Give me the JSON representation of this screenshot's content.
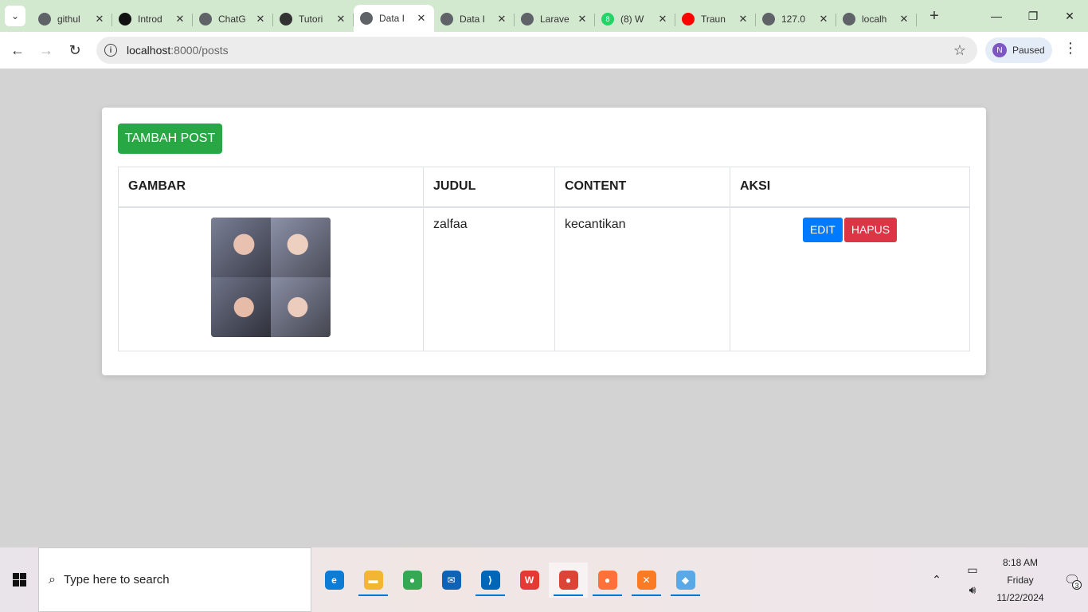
{
  "browser": {
    "tabs": [
      {
        "title": "githul",
        "favicon": "globe-icon",
        "color": "#5f6368"
      },
      {
        "title": "Introd",
        "favicon": "openai-icon",
        "color": "#111111"
      },
      {
        "title": "ChatG",
        "favicon": "openai-icon",
        "color": "#5f6368"
      },
      {
        "title": "Tutori",
        "favicon": "github-icon",
        "color": "#333333"
      },
      {
        "title": "Data I",
        "favicon": "globe-icon",
        "color": "#5f6368",
        "active": true
      },
      {
        "title": "Data I",
        "favicon": "globe-icon",
        "color": "#5f6368"
      },
      {
        "title": "Larave",
        "favicon": "globe-icon",
        "color": "#5f6368"
      },
      {
        "title": "(8) W",
        "favicon": "whatsapp-icon",
        "color": "#25d366",
        "badge": "8"
      },
      {
        "title": "Traun",
        "favicon": "youtube-icon",
        "color": "#ff0000"
      },
      {
        "title": "127.0",
        "favicon": "globe-icon",
        "color": "#5f6368"
      },
      {
        "title": "localh",
        "favicon": "globe-icon",
        "color": "#5f6368"
      }
    ],
    "url_host": "localhost",
    "url_path": ":8000/posts",
    "profile_initial": "N",
    "profile_label": "Paused"
  },
  "page": {
    "add_button": "TAMBAH POST",
    "table": {
      "headers": [
        "GAMBAR",
        "JUDUL",
        "CONTENT",
        "AKSI"
      ],
      "rows": [
        {
          "judul": "zalfaa",
          "content": "kecantikan",
          "edit_label": "EDIT",
          "delete_label": "HAPUS"
        }
      ]
    }
  },
  "colors": {
    "add_button": "#28a745",
    "edit_button": "#007bff",
    "delete_button": "#dc3545",
    "page_background": "#d3d3d3"
  },
  "taskbar": {
    "search_placeholder": "Type here to search",
    "time": "8:18 AM",
    "day": "Friday",
    "date": "11/22/2024",
    "notification_count": "3",
    "pinned": [
      {
        "name": "edge-icon",
        "color": "#0c7cd5",
        "glyph": "e"
      },
      {
        "name": "file-explorer-icon",
        "color": "#f2b632",
        "glyph": "▬",
        "running": true
      },
      {
        "name": "chrome-icon",
        "color": "#34a853",
        "glyph": "●"
      },
      {
        "name": "mail-icon",
        "color": "#0e63b7",
        "glyph": "✉"
      },
      {
        "name": "vscode-icon",
        "color": "#0066b8",
        "glyph": "⟩",
        "running": true
      },
      {
        "name": "wps-icon",
        "color": "#e53935",
        "glyph": "W"
      },
      {
        "name": "chrome-profile-icon",
        "color": "#db4437",
        "glyph": "●",
        "running": true,
        "active": true
      },
      {
        "name": "firefox-icon",
        "color": "#ff7139",
        "glyph": "●",
        "running": true
      },
      {
        "name": "xampp-icon",
        "color": "#fb7a24",
        "glyph": "✕",
        "running": true
      },
      {
        "name": "git-icon",
        "color": "#5aa9e6",
        "glyph": "◆",
        "running": true
      }
    ]
  }
}
